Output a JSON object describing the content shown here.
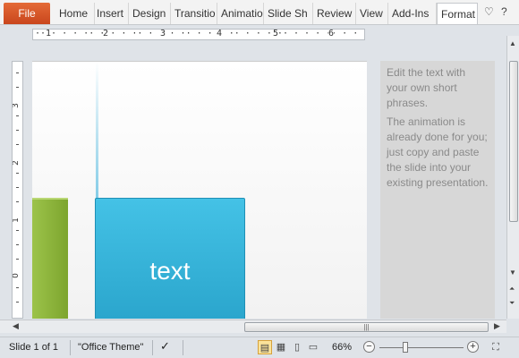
{
  "ribbon": {
    "file_label": "File",
    "tabs": [
      "Home",
      "Insert",
      "Design",
      "Transitio",
      "Animatio",
      "Slide Sh",
      "Review",
      "View",
      "Add-Ins",
      "Format"
    ],
    "active_tab": "Format"
  },
  "ruler": {
    "horizontal": [
      "1",
      "2",
      "3",
      "4",
      "5",
      "6"
    ],
    "vertical": [
      "3",
      "2",
      "1",
      "0",
      "1"
    ]
  },
  "slide": {
    "bar_text": "text"
  },
  "notes": {
    "paragraph1": "Edit the text with your own short phrases.",
    "paragraph2": "The animation is already done for you; just copy and paste the slide into your existing presentation."
  },
  "status": {
    "slide_info": "Slide 1 of 1",
    "theme": "\"Office Theme\"",
    "zoom": "66%"
  },
  "colors": {
    "file_tab": "#d2502a",
    "bar_blue": "#35b3dc",
    "bar_green": "#8cb63c"
  }
}
